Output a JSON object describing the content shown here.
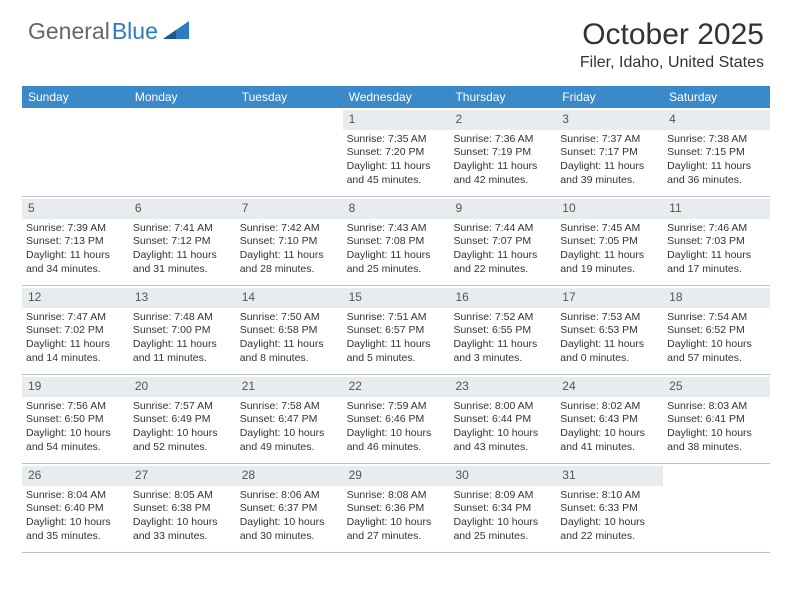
{
  "brand": {
    "part1": "General",
    "part2": "Blue"
  },
  "title": "October 2025",
  "location": "Filer, Idaho, United States",
  "day_headers": [
    "Sunday",
    "Monday",
    "Tuesday",
    "Wednesday",
    "Thursday",
    "Friday",
    "Saturday"
  ],
  "weeks": [
    [
      {
        "empty": true
      },
      {
        "empty": true
      },
      {
        "empty": true
      },
      {
        "num": "1",
        "sunrise": "7:35 AM",
        "sunset": "7:20 PM",
        "daylight": "11 hours and 45 minutes."
      },
      {
        "num": "2",
        "sunrise": "7:36 AM",
        "sunset": "7:19 PM",
        "daylight": "11 hours and 42 minutes."
      },
      {
        "num": "3",
        "sunrise": "7:37 AM",
        "sunset": "7:17 PM",
        "daylight": "11 hours and 39 minutes."
      },
      {
        "num": "4",
        "sunrise": "7:38 AM",
        "sunset": "7:15 PM",
        "daylight": "11 hours and 36 minutes."
      }
    ],
    [
      {
        "num": "5",
        "sunrise": "7:39 AM",
        "sunset": "7:13 PM",
        "daylight": "11 hours and 34 minutes."
      },
      {
        "num": "6",
        "sunrise": "7:41 AM",
        "sunset": "7:12 PM",
        "daylight": "11 hours and 31 minutes."
      },
      {
        "num": "7",
        "sunrise": "7:42 AM",
        "sunset": "7:10 PM",
        "daylight": "11 hours and 28 minutes."
      },
      {
        "num": "8",
        "sunrise": "7:43 AM",
        "sunset": "7:08 PM",
        "daylight": "11 hours and 25 minutes."
      },
      {
        "num": "9",
        "sunrise": "7:44 AM",
        "sunset": "7:07 PM",
        "daylight": "11 hours and 22 minutes."
      },
      {
        "num": "10",
        "sunrise": "7:45 AM",
        "sunset": "7:05 PM",
        "daylight": "11 hours and 19 minutes."
      },
      {
        "num": "11",
        "sunrise": "7:46 AM",
        "sunset": "7:03 PM",
        "daylight": "11 hours and 17 minutes."
      }
    ],
    [
      {
        "num": "12",
        "sunrise": "7:47 AM",
        "sunset": "7:02 PM",
        "daylight": "11 hours and 14 minutes."
      },
      {
        "num": "13",
        "sunrise": "7:48 AM",
        "sunset": "7:00 PM",
        "daylight": "11 hours and 11 minutes."
      },
      {
        "num": "14",
        "sunrise": "7:50 AM",
        "sunset": "6:58 PM",
        "daylight": "11 hours and 8 minutes."
      },
      {
        "num": "15",
        "sunrise": "7:51 AM",
        "sunset": "6:57 PM",
        "daylight": "11 hours and 5 minutes."
      },
      {
        "num": "16",
        "sunrise": "7:52 AM",
        "sunset": "6:55 PM",
        "daylight": "11 hours and 3 minutes."
      },
      {
        "num": "17",
        "sunrise": "7:53 AM",
        "sunset": "6:53 PM",
        "daylight": "11 hours and 0 minutes."
      },
      {
        "num": "18",
        "sunrise": "7:54 AM",
        "sunset": "6:52 PM",
        "daylight": "10 hours and 57 minutes."
      }
    ],
    [
      {
        "num": "19",
        "sunrise": "7:56 AM",
        "sunset": "6:50 PM",
        "daylight": "10 hours and 54 minutes."
      },
      {
        "num": "20",
        "sunrise": "7:57 AM",
        "sunset": "6:49 PM",
        "daylight": "10 hours and 52 minutes."
      },
      {
        "num": "21",
        "sunrise": "7:58 AM",
        "sunset": "6:47 PM",
        "daylight": "10 hours and 49 minutes."
      },
      {
        "num": "22",
        "sunrise": "7:59 AM",
        "sunset": "6:46 PM",
        "daylight": "10 hours and 46 minutes."
      },
      {
        "num": "23",
        "sunrise": "8:00 AM",
        "sunset": "6:44 PM",
        "daylight": "10 hours and 43 minutes."
      },
      {
        "num": "24",
        "sunrise": "8:02 AM",
        "sunset": "6:43 PM",
        "daylight": "10 hours and 41 minutes."
      },
      {
        "num": "25",
        "sunrise": "8:03 AM",
        "sunset": "6:41 PM",
        "daylight": "10 hours and 38 minutes."
      }
    ],
    [
      {
        "num": "26",
        "sunrise": "8:04 AM",
        "sunset": "6:40 PM",
        "daylight": "10 hours and 35 minutes."
      },
      {
        "num": "27",
        "sunrise": "8:05 AM",
        "sunset": "6:38 PM",
        "daylight": "10 hours and 33 minutes."
      },
      {
        "num": "28",
        "sunrise": "8:06 AM",
        "sunset": "6:37 PM",
        "daylight": "10 hours and 30 minutes."
      },
      {
        "num": "29",
        "sunrise": "8:08 AM",
        "sunset": "6:36 PM",
        "daylight": "10 hours and 27 minutes."
      },
      {
        "num": "30",
        "sunrise": "8:09 AM",
        "sunset": "6:34 PM",
        "daylight": "10 hours and 25 minutes."
      },
      {
        "num": "31",
        "sunrise": "8:10 AM",
        "sunset": "6:33 PM",
        "daylight": "10 hours and 22 minutes."
      },
      {
        "empty": true
      }
    ]
  ],
  "labels": {
    "sunrise": "Sunrise:",
    "sunset": "Sunset:",
    "daylight": "Daylight:"
  }
}
